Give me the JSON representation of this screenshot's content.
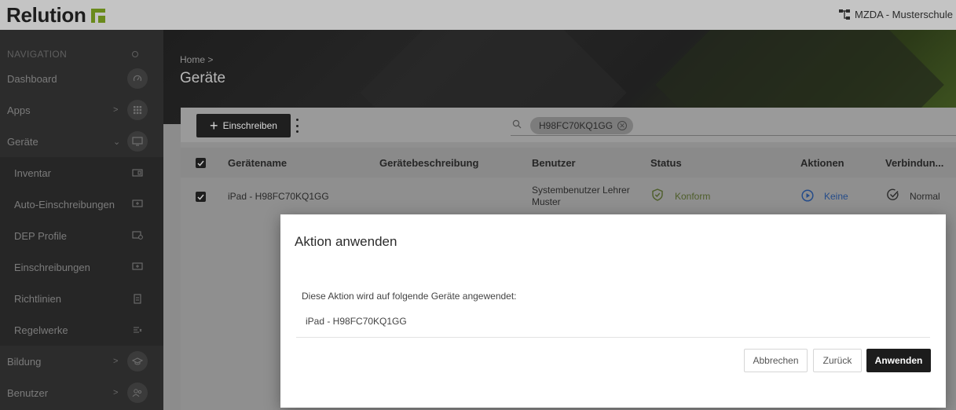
{
  "app": {
    "name": "Relution",
    "organization": "MZDA - Musterschule",
    "colors": {
      "brand": "#6a8a1c",
      "dark": "#1c1c1c",
      "link": "#254c8a",
      "ok": "#4e5e2a"
    }
  },
  "sidebar": {
    "heading": "NAVIGATION",
    "items": [
      {
        "label": "Dashboard",
        "icon": "dashboard-gauge-icon"
      },
      {
        "label": "Apps",
        "chevron": ">",
        "icon": "apps-grid-icon"
      },
      {
        "label": "Geräte",
        "chevron": "⌄",
        "icon": "devices-icon"
      },
      {
        "label": "Inventar",
        "icon": "inventory-icon"
      },
      {
        "label": "Auto-Einschreibungen",
        "icon": "auto-enroll-icon"
      },
      {
        "label": "DEP Profile",
        "icon": "dep-profile-icon"
      },
      {
        "label": "Einschreibungen",
        "icon": "enrollment-icon"
      },
      {
        "label": "Richtlinien",
        "icon": "policy-icon"
      },
      {
        "label": "Regelwerke",
        "icon": "ruleset-icon"
      },
      {
        "label": "Bildung",
        "chevron": ">",
        "icon": "education-cap-icon"
      },
      {
        "label": "Benutzer",
        "chevron": ">",
        "icon": "users-icon"
      }
    ]
  },
  "header": {
    "breadcrumb": "Home >",
    "title": "Geräte"
  },
  "toolbar": {
    "enroll_label": "Einschreiben",
    "search_chip": "H98FC70KQ1GG"
  },
  "table": {
    "columns": [
      "Gerätename",
      "Gerätebeschreibung",
      "Benutzer",
      "Status",
      "Aktionen",
      "Verbindun..."
    ],
    "rows": [
      {
        "device": "iPad - H98FC70KQ1GG",
        "description": "",
        "user_line1": "Systembenutzer Lehrer",
        "user_line2": "Muster",
        "status": "Konform",
        "actions": "Keine",
        "connection": "Normal"
      }
    ]
  },
  "dialog": {
    "title": "Aktion anwenden",
    "description": "Diese Aktion wird auf folgende Geräte angewendet:",
    "device": "iPad - H98FC70KQ1GG",
    "cancel_label": "Abbrechen",
    "back_label": "Zurück",
    "apply_label": "Anwenden"
  }
}
